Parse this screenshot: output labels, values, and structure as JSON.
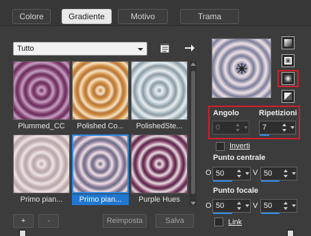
{
  "tabs": [
    {
      "label": "Colore",
      "active": false
    },
    {
      "label": "Gradiente",
      "active": true
    },
    {
      "label": "Motivo",
      "active": false
    },
    {
      "label": "Trama",
      "active": false
    }
  ],
  "library": {
    "dropdown_value": "Tutto",
    "presets": [
      {
        "name": "Plummed_CC",
        "colors": [
          "#6a2a5a",
          "#c7a0c3",
          "#8a4a7a"
        ],
        "selected": false
      },
      {
        "name": "Polished Co...",
        "colors": [
          "#d08a3a",
          "#f5e3c6",
          "#b8763a"
        ],
        "selected": false
      },
      {
        "name": "PolishedSte...",
        "colors": [
          "#8b9aa3",
          "#e8eef1",
          "#b2c0c6"
        ],
        "selected": false
      },
      {
        "name": "Primo pian...",
        "colors": [
          "#b7a6a7",
          "#efe4e3",
          "#c9b7b8"
        ],
        "selected": false
      },
      {
        "name": "Primo pian...",
        "colors": [
          "#6b6c88",
          "#f1dfe3",
          "#9a8aa6"
        ],
        "selected": true
      },
      {
        "name": "Purple Hues",
        "colors": [
          "#5a2345",
          "#e8dde3",
          "#8c4d72"
        ],
        "selected": false
      }
    ],
    "buttons": {
      "add": "+",
      "remove": "-",
      "reset": "Reimposta",
      "save": "Salva"
    }
  },
  "gradient": {
    "preview_colors": [
      "#7a7d9a",
      "#efe2e6"
    ],
    "angle_label": "Angolo",
    "angle_value": "0",
    "repeats_label": "Ripetizioni",
    "repeats_value": "7",
    "invert_label": "Inverti",
    "center_label": "Punto centrale",
    "center_x_label": "O",
    "center_x": "50",
    "center_y_label": "V",
    "center_y": "50",
    "focal_label": "Punto focale",
    "focal_x_label": "O",
    "focal_x": "50",
    "focal_y_label": "V",
    "focal_y": "50",
    "link_label": "Link"
  },
  "accent_colors": {
    "selection": "#1f77d0",
    "highlight_box": "#d41f2c"
  }
}
